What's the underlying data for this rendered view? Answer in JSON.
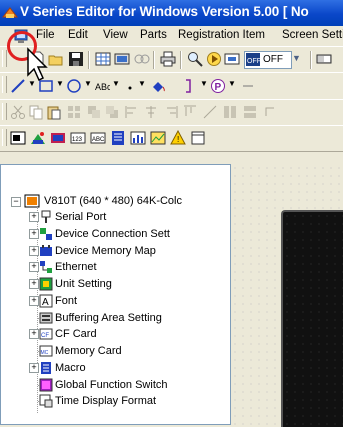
{
  "window": {
    "title": "V Series Editor for Windows Version 5.00 [ No"
  },
  "menubar": {
    "items": [
      "File",
      "Edit",
      "View",
      "Parts",
      "Registration Item",
      "Screen Setti"
    ]
  },
  "toolbar": {
    "combo_value": "OFF"
  },
  "tree": {
    "root_label": "V810T (640 * 480) 64K-Colc",
    "items": [
      {
        "label": "Serial Port",
        "icon": "serial-port-icon"
      },
      {
        "label": "Device Connection Sett",
        "icon": "device-connection-icon"
      },
      {
        "label": "Device Memory Map",
        "icon": "device-memory-map-icon"
      },
      {
        "label": "Ethernet",
        "icon": "ethernet-icon"
      },
      {
        "label": "Unit Setting",
        "icon": "unit-setting-icon"
      },
      {
        "label": "Font",
        "icon": "font-icon"
      },
      {
        "label": "Buffering Area Setting",
        "icon": "buffering-area-icon"
      },
      {
        "label": "CF Card",
        "icon": "cf-card-icon"
      },
      {
        "label": "Memory Card",
        "icon": "memory-card-icon"
      },
      {
        "label": "Macro",
        "icon": "macro-icon"
      },
      {
        "label": "Global Function Switch",
        "icon": "global-function-switch-icon"
      },
      {
        "label": "Time Display Format",
        "icon": "time-display-format-icon"
      }
    ]
  },
  "panel": {
    "close_glyph": "×"
  },
  "colors": {
    "titlebar": "#0a47c9",
    "highlight_circle": "#e02020"
  }
}
